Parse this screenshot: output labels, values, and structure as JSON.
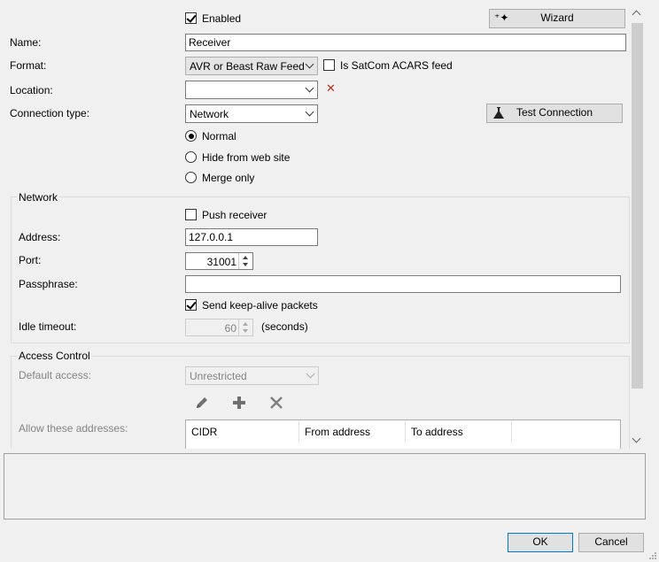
{
  "form": {
    "enabled_label": "Enabled",
    "enabled_checked": true,
    "wizard_label": "Wizard",
    "name_label": "Name:",
    "name_value": "Receiver",
    "format_label": "Format:",
    "format_value": "AVR or Beast Raw Feed",
    "satcom_label": "Is SatCom ACARS feed",
    "satcom_checked": false,
    "location_label": "Location:",
    "location_value": "",
    "connection_type_label": "Connection type:",
    "connection_type_value": "Network",
    "test_connection_label": "Test Connection",
    "radios": [
      {
        "label": "Normal",
        "checked": true
      },
      {
        "label": "Hide from web site",
        "checked": false
      },
      {
        "label": "Merge only",
        "checked": false
      }
    ]
  },
  "network": {
    "title": "Network",
    "push_receiver_label": "Push receiver",
    "push_receiver_checked": false,
    "address_label": "Address:",
    "address_value": "127.0.0.1",
    "port_label": "Port:",
    "port_value": "31001",
    "passphrase_label": "Passphrase:",
    "passphrase_value": "",
    "keepalive_label": "Send keep-alive packets",
    "keepalive_checked": true,
    "idle_timeout_label": "Idle timeout:",
    "idle_timeout_value": "60",
    "idle_timeout_unit": "(seconds)"
  },
  "access": {
    "title": "Access Control",
    "default_access_label": "Default access:",
    "default_access_value": "Unrestricted",
    "allow_label": "Allow these addresses:",
    "columns": [
      "CIDR",
      "From address",
      "To address"
    ]
  },
  "footer": {
    "ok_label": "OK",
    "cancel_label": "Cancel"
  },
  "colors": {
    "accent": "#0078d7",
    "delete_red": "#c42b1c"
  }
}
